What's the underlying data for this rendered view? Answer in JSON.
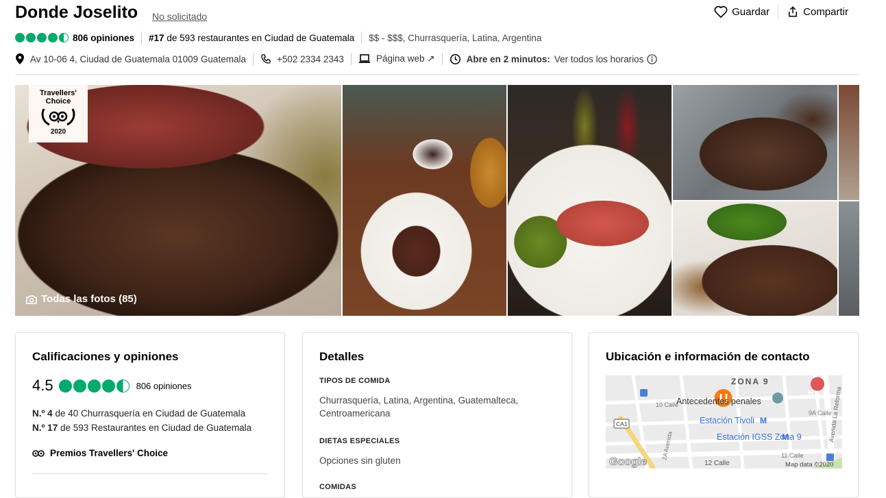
{
  "header": {
    "title": "Donde Joselito",
    "unclaimed": "No solicitado",
    "save_label": "Guardar",
    "share_label": "Compartir",
    "review_count": "806 opiniones",
    "rank_bold": "#17",
    "rank_rest": " de 593 restaurantes en Ciudad de Guatemala",
    "price_cuisine": "$$ - $$$, Churrasquería, Latina, Argentina",
    "address": "Av 10-06 4, Ciudad de Guatemala 01009 Guatemala",
    "phone": "+502 2334 2343",
    "website": "Página web ↗",
    "open_status": "Abre en 2 minutos:",
    "hours_link": "Ver todos los horarios",
    "rating_value": 4.5
  },
  "gallery": {
    "badge_line1": "Travellers'",
    "badge_line2": "Choice",
    "badge_year": "2020",
    "all_photos": "Todas las fotos (85)"
  },
  "ratings_card": {
    "title": "Calificaciones y opiniones",
    "rating": "4.5",
    "review_count": "806 opiniones",
    "rank1_bold": "N.º 4",
    "rank1_rest": " de 40 Churrasquería en Ciudad de Guatemala",
    "rank2_bold": "N.º 17",
    "rank2_rest": " de 593 Restaurantes en Ciudad de Guatemala",
    "award": "Premios Travellers' Choice"
  },
  "details_card": {
    "title": "Detalles",
    "food_types_label": "TIPOS DE COMIDA",
    "food_types_value": "Churrasquería, Latina, Argentina, Guatemalteca, Centroamericana",
    "diets_label": "DIETAS ESPECIALES",
    "diets_value": "Opciones sin gluten",
    "meals_label": "COMIDAS"
  },
  "location_card": {
    "title": "Ubicación e información de contacto",
    "map_labels": {
      "zone": "ZONA 9",
      "antecedentes": "Antecedentes penales",
      "tivoli": "Estación Tivoli",
      "igss": "Estación IGSS Zona 9",
      "calle10": "10 Calle",
      "calle9a": "9A Calle",
      "calle11": "11 Calle",
      "calle12": "12 Calle",
      "ca1": "CA1",
      "avenida2a": "2A Avenida",
      "reforma": "Avenida La Reforma",
      "google": "Google",
      "mapdata": "Map data ©2020"
    }
  },
  "colors": {
    "brand_green": "#00aa6c",
    "marker_orange": "#f27b16"
  }
}
